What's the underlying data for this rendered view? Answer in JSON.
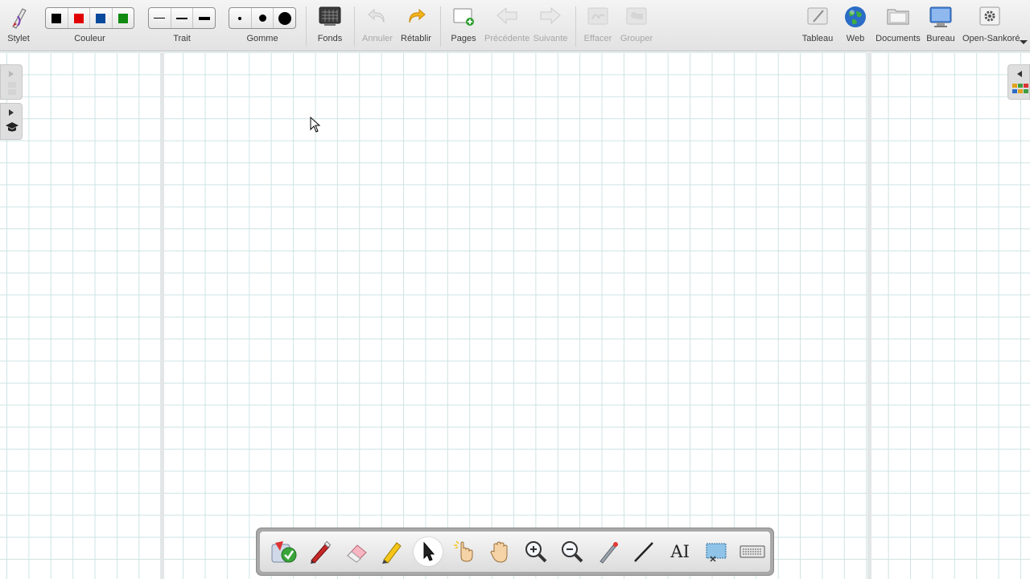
{
  "toolbar": {
    "stylet": "Stylet",
    "couleur": "Couleur",
    "trait": "Trait",
    "gomme": "Gomme",
    "fonds": "Fonds",
    "annuler": "Annuler",
    "retablir": "Rétablir",
    "pages": "Pages",
    "precedente": "Précédente",
    "suivante": "Suivante",
    "effacer": "Effacer",
    "grouper": "Grouper",
    "tableau": "Tableau",
    "web": "Web",
    "documents": "Documents",
    "bureau": "Bureau",
    "open_sankore": "Open-Sankoré"
  },
  "colors": {
    "palette": [
      "#000000",
      "#e10000",
      "#0a4a9c",
      "#108a10"
    ],
    "grid": "#cfe3e3",
    "toolbar_bg": "#e8e8e8"
  },
  "dock_icons": [
    "pointer-tools-icon",
    "pen-icon",
    "eraser-icon",
    "highlighter-icon",
    "selection-arrow-icon",
    "laser-hand-icon",
    "pan-hand-icon",
    "zoom-in-icon",
    "zoom-out-icon",
    "laser-pointer-icon",
    "line-icon",
    "text-icon",
    "capture-icon",
    "keyboard-icon"
  ],
  "dock_text_tool": "AI"
}
